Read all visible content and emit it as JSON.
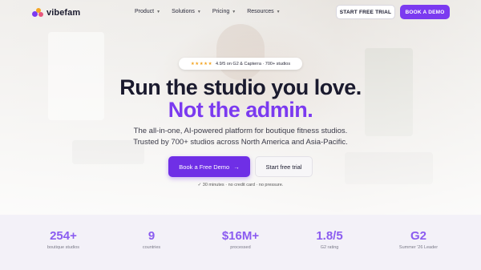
{
  "brand": {
    "name": "vibefam",
    "accent": "#7b3af0"
  },
  "nav": {
    "items": [
      {
        "label": "Product"
      },
      {
        "label": "Solutions"
      },
      {
        "label": "Pricing"
      },
      {
        "label": "Resources"
      }
    ],
    "trial_label": "START FREE TRIAL",
    "demo_label": "BOOK A DEMO"
  },
  "hero": {
    "rating_stars": "★★★★★",
    "rating_text": "4.9/5 on G2 & Capterra · 700+ studios",
    "headline_1": "Run the studio you love.",
    "headline_2": "Not the admin.",
    "subtitle_1": "The all-in-one, AI-powered platform for boutique fitness studios.",
    "subtitle_2": "Trusted by 700+ studios across North America and Asia-Pacific.",
    "cta_primary": "Book a Free Demo",
    "cta_primary_arrow": "→",
    "cta_secondary": "Start free trial",
    "note_check": "✓",
    "note": "30 minutes · no credit card · no pressure."
  },
  "stats": [
    {
      "value": "254+",
      "label": "boutique studios"
    },
    {
      "value": "9",
      "label": "countries"
    },
    {
      "value": "$16M+",
      "label": "processed"
    },
    {
      "value": "1.8/5",
      "label": "G2 rating"
    },
    {
      "value": "G2",
      "label": "Summer '26 Leader"
    }
  ]
}
